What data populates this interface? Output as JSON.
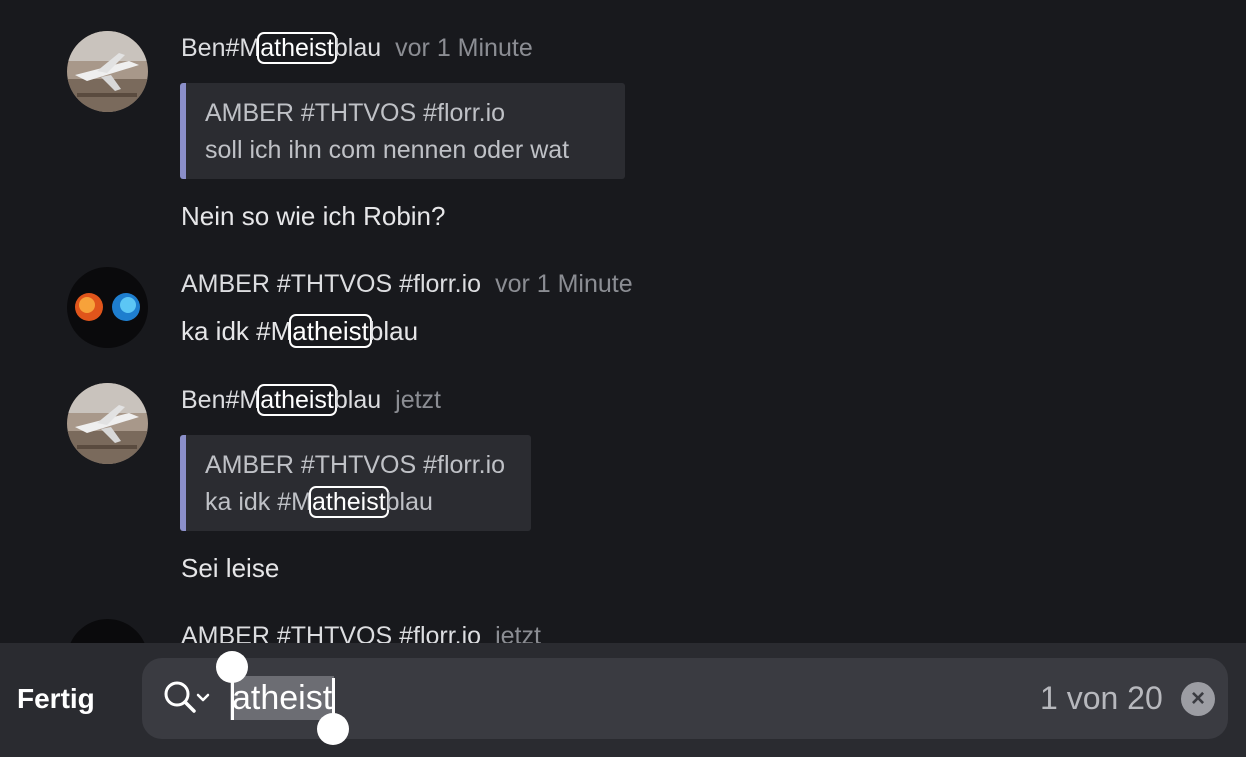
{
  "messages": [
    {
      "author_pre": "Ben#M",
      "author_hl": "atheist",
      "author_post": "blau",
      "time": "vor 1 Minute",
      "quote": {
        "author": "AMBER #THTVOS #florr.io",
        "text": "soll ich ihn com nennen oder wat"
      },
      "body": "Nein so wie ich Robin?"
    },
    {
      "author": "AMBER #THTVOS #florr.io",
      "time": "vor 1 Minute",
      "body_pre": "ka idk #M",
      "body_hl": "atheist",
      "body_post": "blau"
    },
    {
      "author_pre": "Ben#M",
      "author_hl": "atheist",
      "author_post": "blau",
      "time": "jetzt",
      "quote": {
        "author": "AMBER #THTVOS #florr.io",
        "text_pre": "ka idk #M",
        "text_hl": "atheist",
        "text_post": "blau"
      },
      "body": "Sei leise"
    },
    {
      "author": "AMBER #THTVOS #florr.io",
      "time": "jetzt"
    }
  ],
  "findbar": {
    "done_label": "Fertig",
    "query": "atheist",
    "match_count": "1 von 20",
    "search_icon": "magnifier-chevron-icon",
    "clear_icon": "clear-x-icon"
  },
  "colors": {
    "background": "#18191d",
    "quote_accent": "#8b8fc9",
    "findbar_bg": "#2a2b30"
  }
}
